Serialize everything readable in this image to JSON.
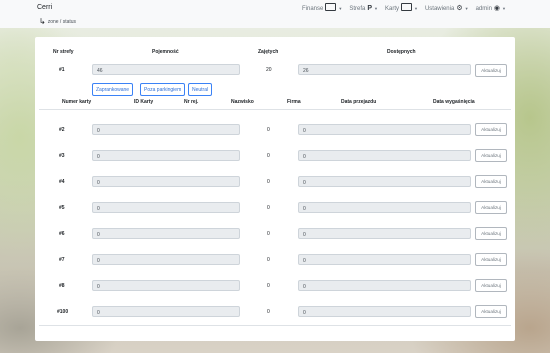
{
  "navbar": {
    "brand": "Cerri",
    "items": [
      {
        "label": "Finanse",
        "icon": "cash-icon"
      },
      {
        "label": "Strefa",
        "icon": "parking-icon"
      },
      {
        "label": "Karty",
        "icon": "card-icon"
      },
      {
        "label": "Ustawienia",
        "icon": "gear-icon"
      },
      {
        "label": "admin",
        "icon": "user-icon"
      }
    ]
  },
  "breadcrumb": "zone / status",
  "zone_table": {
    "headers": {
      "zone": "Nr strefy",
      "capacity": "Pojemność",
      "occupied": "Zajętych",
      "available": "Dostępnych"
    },
    "row": {
      "zone": "#1",
      "capacity": "46",
      "occupied": "20",
      "available": "26",
      "update": "Aktualizuj"
    }
  },
  "toggles": [
    "Zaprankowane",
    "Poza parkingiem",
    "Neutral"
  ],
  "card_table": {
    "headers": {
      "card_number": "Numer karty",
      "card_id": "ID Karty",
      "reg": "Nr rej.",
      "name": "Nazwisko",
      "company": "Firma",
      "entry_date": "Data przejazdu",
      "expiry_date": "Data wygaśnięcia"
    },
    "rows": [
      {
        "label": "#2",
        "id": "0",
        "count": "0",
        "value": "0",
        "update": "Aktualizuj"
      },
      {
        "label": "#3",
        "id": "0",
        "count": "0",
        "value": "0",
        "update": "Aktualizuj"
      },
      {
        "label": "#4",
        "id": "0",
        "count": "0",
        "value": "0",
        "update": "Aktualizuj"
      },
      {
        "label": "#5",
        "id": "0",
        "count": "0",
        "value": "0",
        "update": "Aktualizuj"
      },
      {
        "label": "#6",
        "id": "0",
        "count": "0",
        "value": "0",
        "update": "Aktualizuj"
      },
      {
        "label": "#7",
        "id": "0",
        "count": "0",
        "value": "0",
        "update": "Aktualizuj"
      },
      {
        "label": "#8",
        "id": "0",
        "count": "0",
        "value": "0",
        "update": "Aktualizuj"
      },
      {
        "label": "#100",
        "id": "0",
        "count": "0",
        "value": "0",
        "update": "Aktualizuj"
      }
    ]
  }
}
